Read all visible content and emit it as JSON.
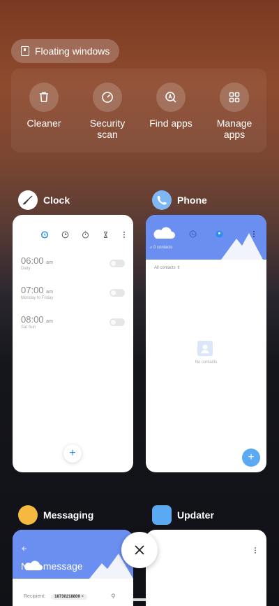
{
  "floating_windows": {
    "label": "Floating windows"
  },
  "tools": [
    {
      "label": "Cleaner",
      "icon": "trash-icon"
    },
    {
      "label": "Security\nscan",
      "icon": "security-scan-icon"
    },
    {
      "label": "Find apps",
      "icon": "find-apps-icon"
    },
    {
      "label": "Manage\napps",
      "icon": "grid-icon"
    }
  ],
  "apps": {
    "clock": {
      "name": "Clock",
      "alarms": [
        {
          "time": "06:00",
          "ampm": "am",
          "repeat": "Daily"
        },
        {
          "time": "07:00",
          "ampm": "am",
          "repeat": "Monday to Friday"
        },
        {
          "time": "08:00",
          "ampm": "am",
          "repeat": "Sat Sun"
        }
      ]
    },
    "phone": {
      "name": "Phone",
      "search_placeholder": "0 contacts",
      "filter": "All contacts",
      "empty_text": "No contacts"
    },
    "messaging": {
      "name": "Messaging",
      "title": "New message",
      "recipient_label": "Recipient:",
      "recipient_number": "18730218809"
    },
    "updater": {
      "name": "Updater"
    }
  },
  "colors": {
    "accent_blue": "#2a8cf0",
    "header_blue": "#6b8ff0",
    "messaging_icon": "#f5b942",
    "updater_icon": "#5aa9f2"
  }
}
